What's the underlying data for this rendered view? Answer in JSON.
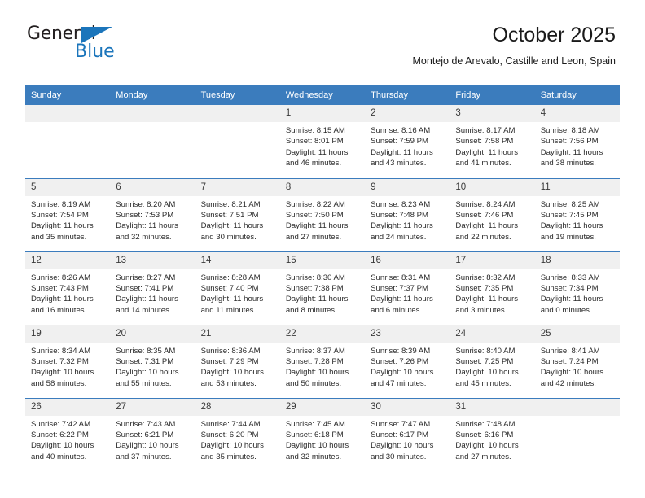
{
  "brand": {
    "name_top": "General",
    "name_bottom": "Blue",
    "flag_icon": "triangle-flag-icon",
    "accent_color": "#1b75bb"
  },
  "header": {
    "title": "October 2025",
    "subtitle": "Montejo de Arevalo, Castille and Leon, Spain"
  },
  "theme": {
    "header_blue": "#3b7cbd",
    "daynum_band": "#f0f0f0",
    "text": "#2b2b2b"
  },
  "calendar": {
    "weekday_headers": [
      "Sunday",
      "Monday",
      "Tuesday",
      "Wednesday",
      "Thursday",
      "Friday",
      "Saturday"
    ],
    "labels": {
      "sunrise": "Sunrise:",
      "sunset": "Sunset:",
      "daylight": "Daylight:"
    },
    "weeks": [
      [
        {
          "day": "",
          "sunrise": "",
          "sunset": "",
          "daylight_1": "",
          "daylight_2": "",
          "empty": true
        },
        {
          "day": "",
          "sunrise": "",
          "sunset": "",
          "daylight_1": "",
          "daylight_2": "",
          "empty": true
        },
        {
          "day": "",
          "sunrise": "",
          "sunset": "",
          "daylight_1": "",
          "daylight_2": "",
          "empty": true
        },
        {
          "day": "1",
          "sunrise": "Sunrise: 8:15 AM",
          "sunset": "Sunset: 8:01 PM",
          "daylight_1": "Daylight: 11 hours",
          "daylight_2": "and 46 minutes."
        },
        {
          "day": "2",
          "sunrise": "Sunrise: 8:16 AM",
          "sunset": "Sunset: 7:59 PM",
          "daylight_1": "Daylight: 11 hours",
          "daylight_2": "and 43 minutes."
        },
        {
          "day": "3",
          "sunrise": "Sunrise: 8:17 AM",
          "sunset": "Sunset: 7:58 PM",
          "daylight_1": "Daylight: 11 hours",
          "daylight_2": "and 41 minutes."
        },
        {
          "day": "4",
          "sunrise": "Sunrise: 8:18 AM",
          "sunset": "Sunset: 7:56 PM",
          "daylight_1": "Daylight: 11 hours",
          "daylight_2": "and 38 minutes."
        }
      ],
      [
        {
          "day": "5",
          "sunrise": "Sunrise: 8:19 AM",
          "sunset": "Sunset: 7:54 PM",
          "daylight_1": "Daylight: 11 hours",
          "daylight_2": "and 35 minutes."
        },
        {
          "day": "6",
          "sunrise": "Sunrise: 8:20 AM",
          "sunset": "Sunset: 7:53 PM",
          "daylight_1": "Daylight: 11 hours",
          "daylight_2": "and 32 minutes."
        },
        {
          "day": "7",
          "sunrise": "Sunrise: 8:21 AM",
          "sunset": "Sunset: 7:51 PM",
          "daylight_1": "Daylight: 11 hours",
          "daylight_2": "and 30 minutes."
        },
        {
          "day": "8",
          "sunrise": "Sunrise: 8:22 AM",
          "sunset": "Sunset: 7:50 PM",
          "daylight_1": "Daylight: 11 hours",
          "daylight_2": "and 27 minutes."
        },
        {
          "day": "9",
          "sunrise": "Sunrise: 8:23 AM",
          "sunset": "Sunset: 7:48 PM",
          "daylight_1": "Daylight: 11 hours",
          "daylight_2": "and 24 minutes."
        },
        {
          "day": "10",
          "sunrise": "Sunrise: 8:24 AM",
          "sunset": "Sunset: 7:46 PM",
          "daylight_1": "Daylight: 11 hours",
          "daylight_2": "and 22 minutes."
        },
        {
          "day": "11",
          "sunrise": "Sunrise: 8:25 AM",
          "sunset": "Sunset: 7:45 PM",
          "daylight_1": "Daylight: 11 hours",
          "daylight_2": "and 19 minutes."
        }
      ],
      [
        {
          "day": "12",
          "sunrise": "Sunrise: 8:26 AM",
          "sunset": "Sunset: 7:43 PM",
          "daylight_1": "Daylight: 11 hours",
          "daylight_2": "and 16 minutes."
        },
        {
          "day": "13",
          "sunrise": "Sunrise: 8:27 AM",
          "sunset": "Sunset: 7:41 PM",
          "daylight_1": "Daylight: 11 hours",
          "daylight_2": "and 14 minutes."
        },
        {
          "day": "14",
          "sunrise": "Sunrise: 8:28 AM",
          "sunset": "Sunset: 7:40 PM",
          "daylight_1": "Daylight: 11 hours",
          "daylight_2": "and 11 minutes."
        },
        {
          "day": "15",
          "sunrise": "Sunrise: 8:30 AM",
          "sunset": "Sunset: 7:38 PM",
          "daylight_1": "Daylight: 11 hours",
          "daylight_2": "and 8 minutes."
        },
        {
          "day": "16",
          "sunrise": "Sunrise: 8:31 AM",
          "sunset": "Sunset: 7:37 PM",
          "daylight_1": "Daylight: 11 hours",
          "daylight_2": "and 6 minutes."
        },
        {
          "day": "17",
          "sunrise": "Sunrise: 8:32 AM",
          "sunset": "Sunset: 7:35 PM",
          "daylight_1": "Daylight: 11 hours",
          "daylight_2": "and 3 minutes."
        },
        {
          "day": "18",
          "sunrise": "Sunrise: 8:33 AM",
          "sunset": "Sunset: 7:34 PM",
          "daylight_1": "Daylight: 11 hours",
          "daylight_2": "and 0 minutes."
        }
      ],
      [
        {
          "day": "19",
          "sunrise": "Sunrise: 8:34 AM",
          "sunset": "Sunset: 7:32 PM",
          "daylight_1": "Daylight: 10 hours",
          "daylight_2": "and 58 minutes."
        },
        {
          "day": "20",
          "sunrise": "Sunrise: 8:35 AM",
          "sunset": "Sunset: 7:31 PM",
          "daylight_1": "Daylight: 10 hours",
          "daylight_2": "and 55 minutes."
        },
        {
          "day": "21",
          "sunrise": "Sunrise: 8:36 AM",
          "sunset": "Sunset: 7:29 PM",
          "daylight_1": "Daylight: 10 hours",
          "daylight_2": "and 53 minutes."
        },
        {
          "day": "22",
          "sunrise": "Sunrise: 8:37 AM",
          "sunset": "Sunset: 7:28 PM",
          "daylight_1": "Daylight: 10 hours",
          "daylight_2": "and 50 minutes."
        },
        {
          "day": "23",
          "sunrise": "Sunrise: 8:39 AM",
          "sunset": "Sunset: 7:26 PM",
          "daylight_1": "Daylight: 10 hours",
          "daylight_2": "and 47 minutes."
        },
        {
          "day": "24",
          "sunrise": "Sunrise: 8:40 AM",
          "sunset": "Sunset: 7:25 PM",
          "daylight_1": "Daylight: 10 hours",
          "daylight_2": "and 45 minutes."
        },
        {
          "day": "25",
          "sunrise": "Sunrise: 8:41 AM",
          "sunset": "Sunset: 7:24 PM",
          "daylight_1": "Daylight: 10 hours",
          "daylight_2": "and 42 minutes."
        }
      ],
      [
        {
          "day": "26",
          "sunrise": "Sunrise: 7:42 AM",
          "sunset": "Sunset: 6:22 PM",
          "daylight_1": "Daylight: 10 hours",
          "daylight_2": "and 40 minutes."
        },
        {
          "day": "27",
          "sunrise": "Sunrise: 7:43 AM",
          "sunset": "Sunset: 6:21 PM",
          "daylight_1": "Daylight: 10 hours",
          "daylight_2": "and 37 minutes."
        },
        {
          "day": "28",
          "sunrise": "Sunrise: 7:44 AM",
          "sunset": "Sunset: 6:20 PM",
          "daylight_1": "Daylight: 10 hours",
          "daylight_2": "and 35 minutes."
        },
        {
          "day": "29",
          "sunrise": "Sunrise: 7:45 AM",
          "sunset": "Sunset: 6:18 PM",
          "daylight_1": "Daylight: 10 hours",
          "daylight_2": "and 32 minutes."
        },
        {
          "day": "30",
          "sunrise": "Sunrise: 7:47 AM",
          "sunset": "Sunset: 6:17 PM",
          "daylight_1": "Daylight: 10 hours",
          "daylight_2": "and 30 minutes."
        },
        {
          "day": "31",
          "sunrise": "Sunrise: 7:48 AM",
          "sunset": "Sunset: 6:16 PM",
          "daylight_1": "Daylight: 10 hours",
          "daylight_2": "and 27 minutes."
        },
        {
          "day": "",
          "sunrise": "",
          "sunset": "",
          "daylight_1": "",
          "daylight_2": "",
          "empty": true
        }
      ]
    ]
  }
}
